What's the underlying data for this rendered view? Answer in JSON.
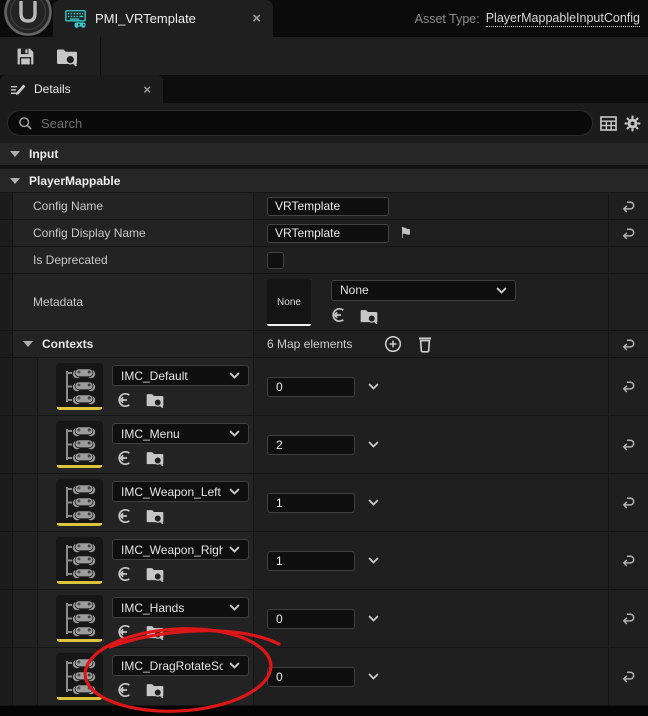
{
  "window": {
    "tab_title": "PMI_VRTemplate",
    "asset_type_label": "Asset Type:",
    "asset_type_value": "PlayerMappableInputConfig"
  },
  "panel": {
    "tab_label": "Details",
    "search_placeholder": "Search"
  },
  "sections": {
    "input": "Input",
    "player_mappable": "PlayerMappable"
  },
  "properties": {
    "config_name": {
      "label": "Config Name",
      "value": "VRTemplate"
    },
    "config_display_name": {
      "label": "Config Display Name",
      "value": "VRTemplate"
    },
    "is_deprecated": {
      "label": "Is Deprecated",
      "checked": false
    },
    "metadata": {
      "label": "Metadata",
      "thumbnail_label": "None",
      "selected_class": "None"
    },
    "contexts_header": {
      "label": "Contexts",
      "summary": "6 Map elements"
    }
  },
  "contexts": {
    "rows": [
      {
        "name": "IMC_Default",
        "priority": "0"
      },
      {
        "name": "IMC_Menu",
        "priority": "2"
      },
      {
        "name": "IMC_Weapon_Left",
        "priority": "1"
      },
      {
        "name": "IMC_Weapon_Right",
        "priority": "1"
      },
      {
        "name": "IMC_Hands",
        "priority": "0"
      },
      {
        "name": "IMC_DragRotateSca",
        "priority": "0"
      }
    ]
  },
  "icons": {
    "close_glyph": "×",
    "flag_glyph": "⚑"
  },
  "colors": {
    "accent_cyan": "#38cfcf",
    "annotation_red": "#dd1717",
    "thumbnail_underline_yellow": "#dcc53c"
  },
  "annotation": {
    "shape": "hand-drawn red ellipse",
    "target": "IMC_DragRotateSca context dropdown"
  }
}
